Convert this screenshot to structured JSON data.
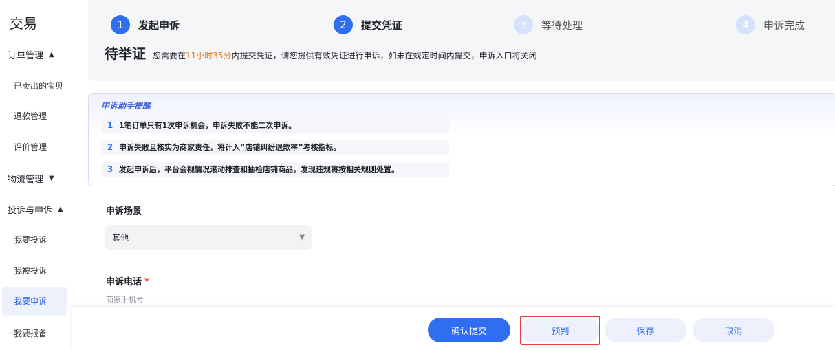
{
  "sidebar": {
    "title": "交易",
    "groups": [
      {
        "label": "订单管理",
        "chevron": "▲"
      },
      {
        "label": "物流管理",
        "chevron": "▼"
      },
      {
        "label": "投诉与申诉",
        "chevron": "▲"
      }
    ],
    "items": [
      {
        "label": "已卖出的宝贝"
      },
      {
        "label": "退款管理"
      },
      {
        "label": "评价管理"
      },
      {
        "label": "我要投诉"
      },
      {
        "label": "我被投诉"
      },
      {
        "label": "我要申诉"
      },
      {
        "label": "我要报备"
      }
    ]
  },
  "steps": [
    {
      "num": "1",
      "label": "发起申诉"
    },
    {
      "num": "2",
      "label": "提交凭证"
    },
    {
      "num": "3",
      "label": "等待处理"
    },
    {
      "num": "4",
      "label": "申诉完成"
    }
  ],
  "status": {
    "title": "待举证",
    "desc_prefix": "您需要在",
    "time": "11小时35分",
    "desc_suffix": "内提交凭证，请您提供有效凭证进行申诉，如未在规定时间内提交，申诉入口将关闭"
  },
  "notice": {
    "title": "申诉助手提醒",
    "items": [
      {
        "num": "1",
        "text": "1笔订单只有1次申诉机会，申诉失败不能二次申诉。"
      },
      {
        "num": "2",
        "text": "申诉失败且核实为商家责任，将计入“店铺纠纷退款率”考核指标。"
      },
      {
        "num": "3",
        "text": "发起申诉后，平台会视情况滚动排查和抽检店铺商品，发现违规将按相关规则处置。"
      }
    ]
  },
  "form": {
    "scene_label": "申诉场景",
    "scene_value": "其他",
    "phone_label": "申诉电话",
    "required_mark": "*",
    "phone_hint": "商家手机号"
  },
  "buttons": {
    "submit": "确认提交",
    "prejudge": "预判",
    "save": "保存",
    "cancel": "取消"
  },
  "colors": {
    "primary": "#2f6ef0",
    "highlight": "#ef7b1a",
    "annotation": "#e04040"
  }
}
